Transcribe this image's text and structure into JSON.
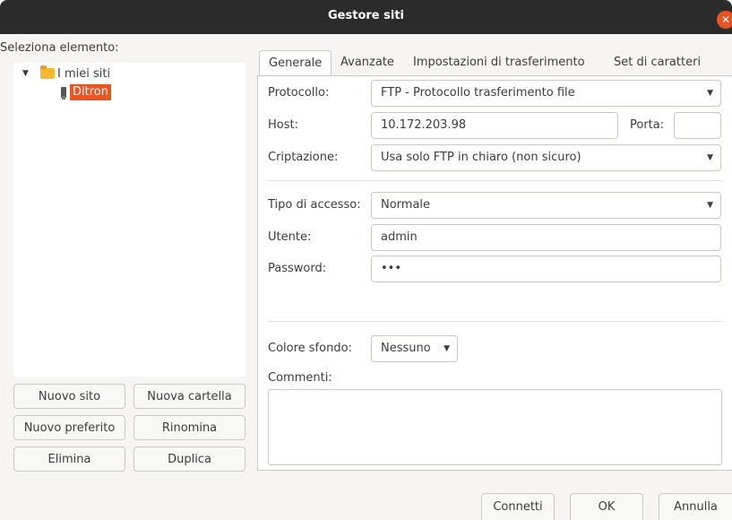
{
  "window": {
    "title": "Gestore siti",
    "close_glyph": "✕"
  },
  "left": {
    "select_label": "Seleziona elemento:",
    "tree": {
      "root": {
        "label": "I miei siti",
        "expander": "▼",
        "icon": "folder-icon"
      },
      "children": [
        {
          "label": "Ditron",
          "icon": "server-icon",
          "selected": true
        }
      ]
    },
    "buttons": {
      "new_site": "Nuovo sito",
      "new_folder": "Nuova cartella",
      "new_bookmark": "Nuovo preferito",
      "rename": "Rinomina",
      "delete": "Elimina",
      "duplicate": "Duplica"
    }
  },
  "tabs": [
    {
      "label": "Generale",
      "active": true
    },
    {
      "label": "Avanzate",
      "active": false
    },
    {
      "label": "Impostazioni di trasferimento",
      "active": false
    },
    {
      "label": "Set di caratteri",
      "active": false
    }
  ],
  "general": {
    "protocol_label": "Protocollo:",
    "protocol_value": "FTP - Protocollo trasferimento file",
    "host_label": "Host:",
    "host_value": "10.172.203.98",
    "port_label": "Porta:",
    "port_value": "",
    "encryption_label": "Criptazione:",
    "encryption_value": "Usa solo FTP in chiaro (non sicuro)",
    "logon_label": "Tipo di accesso:",
    "logon_value": "Normale",
    "user_label": "Utente:",
    "user_value": "admin",
    "password_label": "Password:",
    "password_value": "•••",
    "bg_color_label": "Colore sfondo:",
    "bg_color_value": "Nessuno",
    "comments_label": "Commenti:",
    "comments_value": "",
    "dropdown_glyph": "▼"
  },
  "footer": {
    "connect": "Connetti",
    "ok": "OK",
    "cancel": "Annulla"
  },
  "colors": {
    "accent": "#e95420",
    "titlebar": "#2b2b2b",
    "window_bg": "#f6f5f4",
    "border": "#cdc7c2"
  }
}
